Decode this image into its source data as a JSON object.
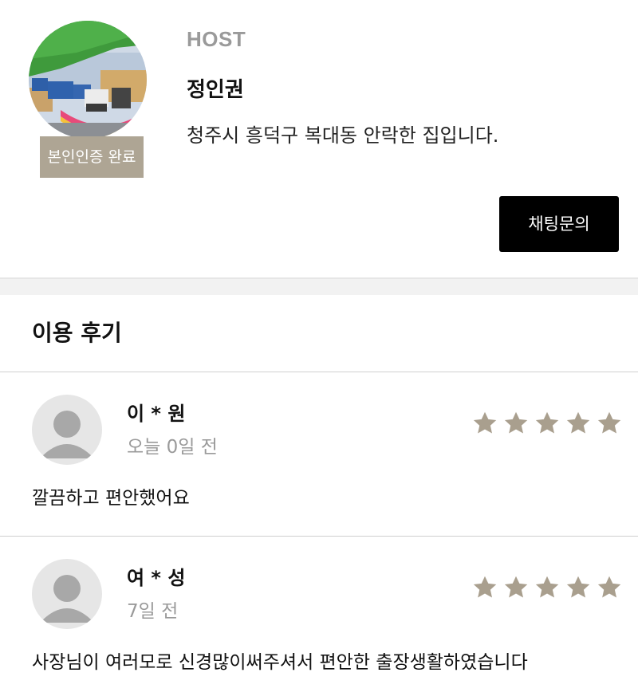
{
  "host": {
    "label": "HOST",
    "name": "정인권",
    "description": "청주시 흥덕구 복대동 안락한 집입니다.",
    "verified_badge": "본인인증 완료",
    "chat_button_label": "채팅문의"
  },
  "reviews_section": {
    "title": "이용 후기"
  },
  "reviews": [
    {
      "name": "이 * 원",
      "date": "오늘 0일 전",
      "rating": 5,
      "text": "깔끔하고 편안했어요"
    },
    {
      "name": "여 * 성",
      "date": "7일 전",
      "rating": 5,
      "text": "사장님이 여러모로 신경많이써주셔서 편안한 출장생활하였습니다"
    }
  ],
  "icons": {
    "star": "star-icon",
    "avatar": "user-silhouette-icon"
  },
  "colors": {
    "star": "#a99f8e",
    "badge": "#aea594",
    "button": "#000000",
    "muted_text": "#9a9a9a"
  }
}
